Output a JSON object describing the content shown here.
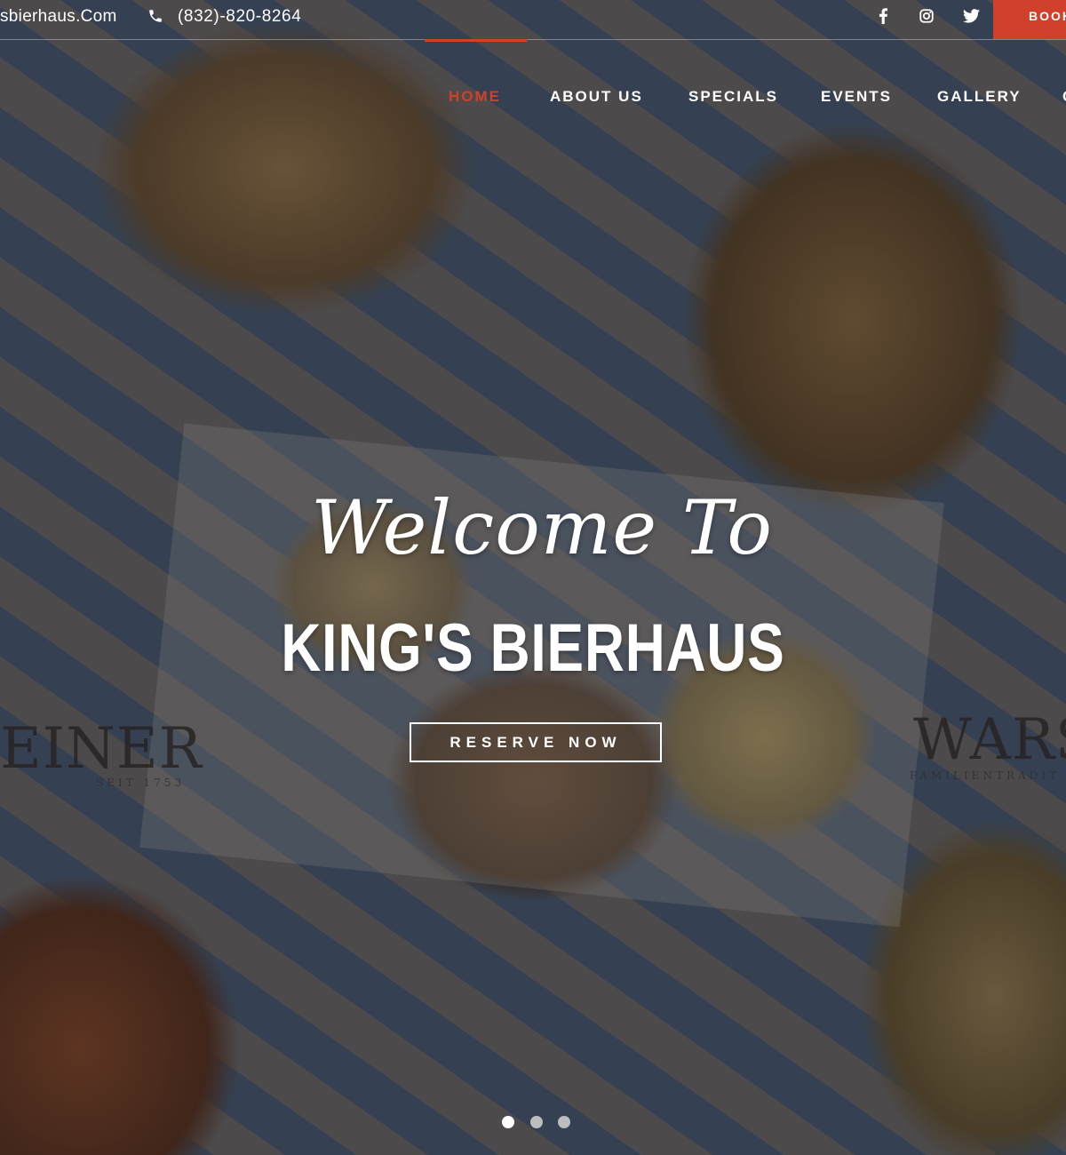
{
  "topbar": {
    "site_url": "sbierhaus.Com",
    "phone": "(832)-820-8264",
    "social_icons": [
      "facebook-icon",
      "instagram-icon",
      "twitter-icon"
    ],
    "book_label": "BOOK"
  },
  "nav": {
    "items": [
      {
        "label": "HOME",
        "active": true
      },
      {
        "label": "ABOUT US",
        "active": false
      },
      {
        "label": "SPECIALS",
        "active": false
      },
      {
        "label": "EVENTS",
        "active": false
      },
      {
        "label": "GALLERY",
        "active": false
      },
      {
        "label": "C",
        "active": false
      }
    ]
  },
  "hero": {
    "welcome": "Welcome To",
    "title": "KING'S BIERHAUS",
    "cta_label": "RESERVE NOW",
    "background_brands": {
      "left": "EINER",
      "left_sub": "SEIT 1753",
      "right": "WARS",
      "right_sub": "FAMILIENTRADIT"
    }
  },
  "carousel": {
    "slides": 3,
    "active_index": 0
  },
  "colors": {
    "accent": "#d0402b",
    "text": "#ffffff",
    "dot_inactive": "#bdbdbd"
  }
}
